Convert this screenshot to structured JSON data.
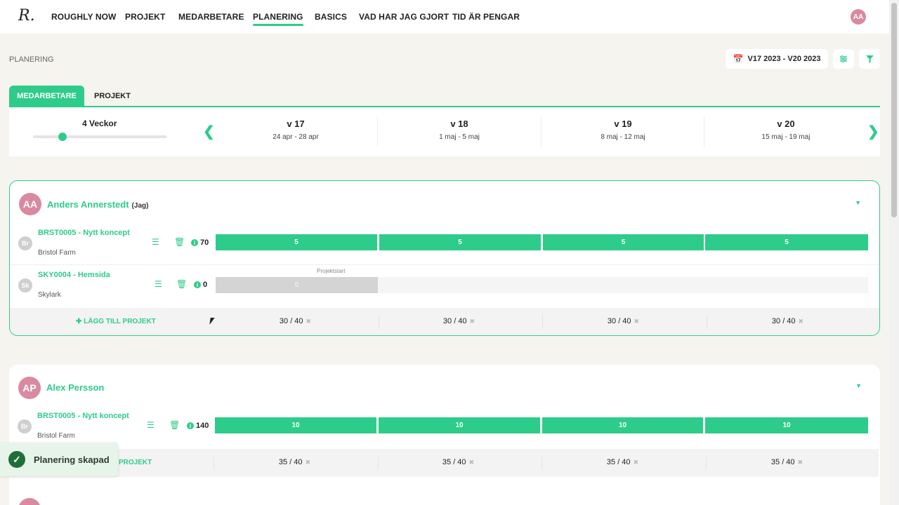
{
  "nav": {
    "logo": "R.",
    "items": [
      "ROUGHLY NOW",
      "PROJEKT",
      "MEDARBETARE",
      "PLANERING",
      "BASICS",
      "VAD HAR JAG GJORT",
      "TID ÄR PENGAR"
    ],
    "active": "PLANERING",
    "user_initials": "AA"
  },
  "page": {
    "title": "PLANERING",
    "date_range": "V17 2023 - V20 2023"
  },
  "tabs": [
    {
      "label": "MEDARBETARE",
      "active": true
    },
    {
      "label": "PROJEKT",
      "active": false
    }
  ],
  "weeks_header": {
    "zoom_label": "4 Veckor",
    "weeks": [
      {
        "week": "v 17",
        "range": "24 apr - 28 apr"
      },
      {
        "week": "v 18",
        "range": "1 maj - 5 maj"
      },
      {
        "week": "v 19",
        "range": "8 maj - 12 maj"
      },
      {
        "week": "v 20",
        "range": "15 maj - 19 maj"
      }
    ]
  },
  "people": [
    {
      "initials": "AA",
      "name": "Anders Annerstedt",
      "me_label": "(Jag)",
      "projects": [
        {
          "avatar": "Br",
          "code": "BRST0005 - Nytt koncept",
          "client": "Bristol Farm",
          "hours": "70",
          "weeks": [
            "5",
            "5",
            "5",
            "5"
          ]
        },
        {
          "avatar": "Sk",
          "code": "SKY0004 - Hemsida",
          "client": "Skylark",
          "hours": "0",
          "start_label": "Projektstart",
          "weeks": [
            "0"
          ]
        }
      ],
      "add_label": "LÄGG TILL PROJEKT",
      "capacity": [
        "30 / 40",
        "30 / 40",
        "30 / 40",
        "30 / 40"
      ]
    },
    {
      "initials": "AP",
      "name": "Alex Persson",
      "projects": [
        {
          "avatar": "Br",
          "code": "BRST0005 - Nytt koncept",
          "client": "Bristol Farm",
          "hours": "140",
          "weeks": [
            "10",
            "10",
            "10",
            "10"
          ]
        }
      ],
      "add_label": "PROJEKT",
      "capacity": [
        "35 / 40",
        "35 / 40",
        "35 / 40",
        "35 / 40"
      ]
    }
  ],
  "toast": {
    "message": "Planering skapad"
  },
  "colors": {
    "accent": "#2ecc8a",
    "avatar": "#d98aa0",
    "background": "#f6f4ee"
  }
}
